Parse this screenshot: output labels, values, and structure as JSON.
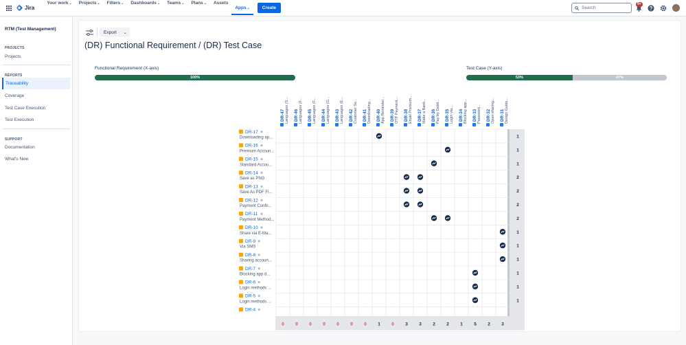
{
  "topbar": {
    "logo": "Jira",
    "nav": [
      {
        "label": "Your work",
        "chev": "⌄",
        "active": false
      },
      {
        "label": "Projects",
        "chev": "⌄",
        "active": false
      },
      {
        "label": "Filters",
        "chev": "⌄",
        "active": false
      },
      {
        "label": "Dashboards",
        "chev": "⌄",
        "active": false
      },
      {
        "label": "Teams",
        "chev": "⌄",
        "active": false
      },
      {
        "label": "Plans",
        "chev": "⌄",
        "active": false
      },
      {
        "label": "Assets",
        "chev": "",
        "active": false
      },
      {
        "label": "Apps",
        "chev": "⌄",
        "active": true
      }
    ],
    "create_label": "Create",
    "search_placeholder": "Search",
    "notifications_badge": "9+",
    "accent": "#0c66e4"
  },
  "sidebar": {
    "title": "RTM (Test Management)",
    "sections": [
      {
        "heading": "PROJECTS",
        "items": [
          {
            "label": "Projects",
            "active": false
          }
        ]
      },
      {
        "heading": "REPORTS",
        "items": [
          {
            "label": "Traceability",
            "active": true
          },
          {
            "label": "Coverage",
            "active": false
          },
          {
            "label": "Test Case Execution",
            "active": false
          },
          {
            "label": "Test Execution",
            "active": false
          }
        ]
      },
      {
        "heading": "SUPPORT",
        "items": [
          {
            "label": "Documentation",
            "active": false
          },
          {
            "label": "What's New",
            "active": false
          }
        ]
      }
    ]
  },
  "main": {
    "export_label": "Export",
    "title": "(DR) Functional Requirement / (DR) Test Case",
    "x_axis": {
      "label": "Functional Requirement (X-axis)",
      "progress": [
        {
          "percent": 100,
          "label": "100%",
          "color": "#216e4e"
        }
      ]
    },
    "y_axis": {
      "label": "Test Case (Y-axis)",
      "progress": [
        {
          "percent": 53,
          "label": "53%",
          "color": "#216e4e"
        },
        {
          "percent": 47,
          "label": "47%",
          "color": "#c1c7d0"
        }
      ]
    }
  },
  "matrix": {
    "columns": [
      {
        "key": "DR-47",
        "text": "Languages (S..."
      },
      {
        "key": "DR-46",
        "text": "Languages (F..."
      },
      {
        "key": "DR-45",
        "text": "Languages (F..."
      },
      {
        "key": "DR-44",
        "text": "Languages (G..."
      },
      {
        "key": "DR-43",
        "text": "Languages (E..."
      },
      {
        "key": "DR-42",
        "text": "Customer Se..."
      },
      {
        "key": "DR-41",
        "text": "Downloading..."
      },
      {
        "key": "DR-40",
        "text": "App Reminder..."
      },
      {
        "key": "DR-39",
        "text": "OTP Payment..."
      },
      {
        "key": "DR-38",
        "text": "Email Premium..."
      },
      {
        "key": "DR-37",
        "text": "Make a Bank..."
      },
      {
        "key": "DR-36",
        "text": "Pay by Debit..."
      },
      {
        "key": "DR-35",
        "text": "Login via..."
      },
      {
        "key": "DR-34",
        "text": "Blocking app..."
      },
      {
        "key": "DR-33",
        "text": "Password..."
      },
      {
        "key": "DR-32",
        "text": "Open sharing..."
      },
      {
        "key": "DR-31",
        "text": "Design Guide..."
      }
    ],
    "rows": [
      {
        "key": "DR-17",
        "text": "Downloading ap...",
        "total": "1"
      },
      {
        "key": "DR-16",
        "text": "Premium Accoun...",
        "total": "1"
      },
      {
        "key": "DR-15",
        "text": "Standard Accou...",
        "total": "1"
      },
      {
        "key": "DR-14",
        "text": "Save as PNG",
        "total": "2"
      },
      {
        "key": "DR-13",
        "text": "Save As PDF Fi...",
        "total": "2"
      },
      {
        "key": "DR-12",
        "text": "Payment Confir...",
        "total": "2"
      },
      {
        "key": "DR-11",
        "text": "Payment Method...",
        "total": "2"
      },
      {
        "key": "DR-10",
        "text": "Share via E-Ma...",
        "total": "1"
      },
      {
        "key": "DR-9",
        "text": "Via SMS",
        "total": "1"
      },
      {
        "key": "DR-8",
        "text": "Sharing accoun...",
        "total": "1"
      },
      {
        "key": "DR-7",
        "text": "Blocking app d...",
        "total": "1"
      },
      {
        "key": "DR-6",
        "text": "Login methods ...",
        "total": "1"
      },
      {
        "key": "DR-5",
        "text": "Login methods ...",
        "total": "1"
      },
      {
        "key": "DR-4",
        "text": "",
        "total": ""
      }
    ],
    "links": [
      [
        0,
        7
      ],
      [
        1,
        12
      ],
      [
        2,
        11
      ],
      [
        3,
        9
      ],
      [
        3,
        10
      ],
      [
        4,
        9
      ],
      [
        4,
        10
      ],
      [
        5,
        9
      ],
      [
        5,
        10
      ],
      [
        6,
        11
      ],
      [
        6,
        12
      ],
      [
        7,
        16
      ],
      [
        8,
        16
      ],
      [
        9,
        16
      ],
      [
        10,
        14
      ],
      [
        11,
        14
      ],
      [
        12,
        14
      ]
    ],
    "column_totals": [
      "0",
      "0",
      "0",
      "0",
      "0",
      "0",
      "0",
      "1",
      "0",
      "3",
      "3",
      "2",
      "2",
      "1",
      "5",
      "2",
      "3"
    ],
    "colors": {
      "key": "#0c66e4",
      "zero_total": "#e2483d",
      "issue_icon": "#fca700",
      "test_icon": "#1d7afc",
      "grid": "#dcdfe4",
      "total_bg": "#e4e6ea"
    }
  }
}
